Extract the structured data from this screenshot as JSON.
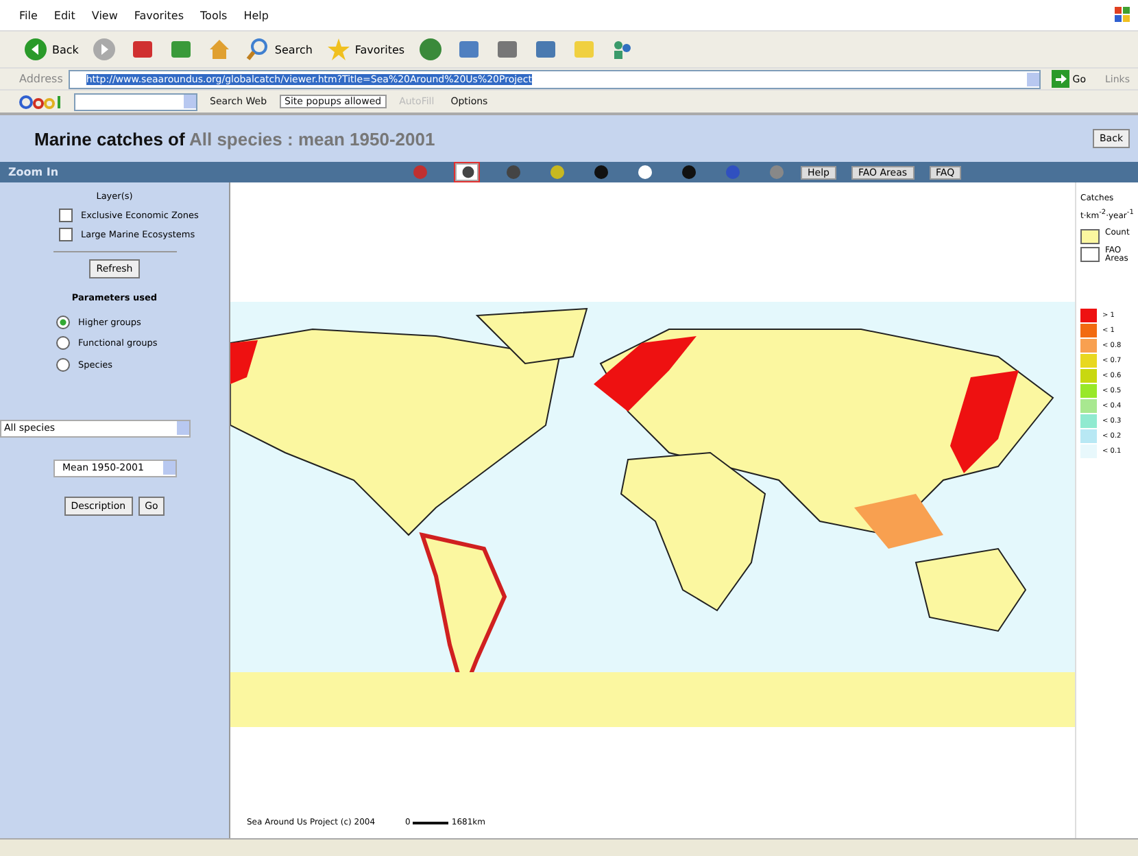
{
  "menu": [
    "File",
    "Edit",
    "View",
    "Favorites",
    "Tools",
    "Help"
  ],
  "toolbar": [
    {
      "kind": "back",
      "label": "Back"
    },
    {
      "kind": "forward"
    },
    {
      "kind": "stop"
    },
    {
      "kind": "refresh"
    },
    {
      "kind": "home"
    },
    {
      "kind": "search",
      "label": "Search"
    },
    {
      "kind": "favorites",
      "label": "Favorites"
    },
    {
      "kind": "history"
    },
    {
      "kind": "mail"
    },
    {
      "kind": "print"
    },
    {
      "kind": "edit"
    },
    {
      "kind": "note"
    },
    {
      "kind": "messenger"
    }
  ],
  "address": {
    "label": "Address",
    "value": "http://www.seaaroundus.org/globalcatch/viewer.htm?Title=Sea%20Around%20Us%20Project",
    "go": "Go",
    "links": "Links"
  },
  "google_bar": {
    "search": "Search Web",
    "popups": "Site popups allowed",
    "autofill": {
      "label": "AutoFill",
      "disabled": true
    },
    "options": "Options"
  },
  "page": {
    "title": "Marine catches of",
    "subject": "All species : mean 1950-2001",
    "back": "Back"
  },
  "map_toolbar": {
    "mode": "Zoom In",
    "tools": [
      {
        "kind": "full",
        "selected": false
      },
      {
        "kind": "zoomin",
        "selected": true
      },
      {
        "kind": "zoomout",
        "selected": false
      },
      {
        "kind": "zoombox",
        "selected": false
      },
      {
        "kind": "previous",
        "selected": false
      },
      {
        "kind": "pan",
        "selected": false
      },
      {
        "kind": "info",
        "selected": false
      },
      {
        "kind": "query",
        "selected": false
      },
      {
        "kind": "print",
        "selected": false
      }
    ],
    "buttons": [
      "Help",
      "FAO Areas",
      "FAQ"
    ]
  },
  "sidebar": {
    "layers_title": "Layer(s)",
    "layers": [
      {
        "label": "Exclusive Economic Zones",
        "checked": false
      },
      {
        "label": "Large Marine Ecosystems",
        "checked": false
      }
    ],
    "refresh": "Refresh",
    "params_title": "Parameters used",
    "params": [
      {
        "label": "Higher groups",
        "selected": true
      },
      {
        "label": "Functional groups",
        "selected": false
      },
      {
        "label": "Species",
        "selected": false
      }
    ],
    "species": "All species",
    "period": "Mean 1950-2001",
    "description": "Description",
    "go": "Go"
  },
  "map": {
    "credit": "Sea Around Us Project (c) 2004",
    "scale_start": "0",
    "scale_end": "1681km"
  },
  "legend": {
    "title": "Catches",
    "unit": "t·km$^{-2}$·year$^{-1}$",
    "layers": [
      {
        "label": "Count",
        "color": "#fbf7a0"
      },
      {
        "label": "FAO Areas",
        "color": "#ffffff"
      }
    ],
    "classes": [
      {
        "label": "> 1",
        "color": "#ee1111"
      },
      {
        "label": "< 1",
        "color": "#f26a10"
      },
      {
        "label": "< 0.8",
        "color": "#f8a050"
      },
      {
        "label": "< 0.7",
        "color": "#e8d820"
      },
      {
        "label": "< 0.6",
        "color": "#c8d810"
      },
      {
        "label": "< 0.5",
        "color": "#98e828"
      },
      {
        "label": "< 0.4",
        "color": "#a8e890"
      },
      {
        "label": "< 0.3",
        "color": "#90ead0"
      },
      {
        "label": "< 0.2",
        "color": "#b8e8f4"
      },
      {
        "label": "< 0.1",
        "color": "#e8f8fc"
      }
    ]
  }
}
